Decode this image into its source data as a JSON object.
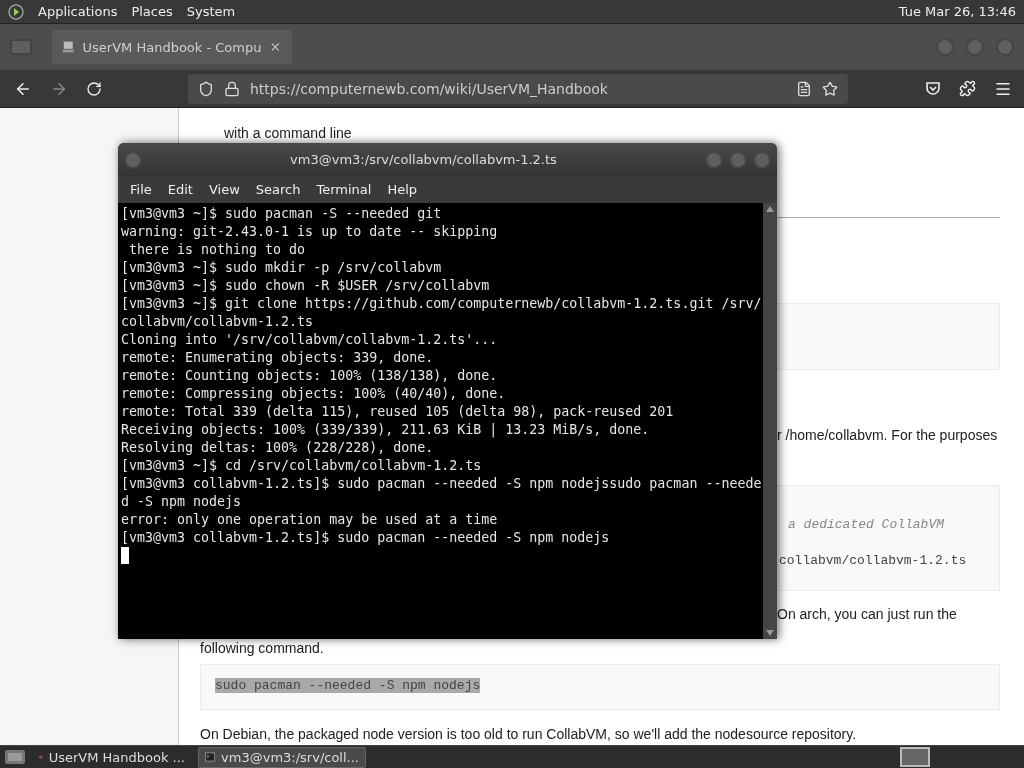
{
  "top_panel": {
    "menus": [
      "Applications",
      "Places",
      "System"
    ],
    "clock": "Tue Mar 26, 13:46"
  },
  "browser": {
    "tab": {
      "title": "UserVM Handbook - Compu",
      "selected": true
    },
    "url": "https://computernewb.com/wiki/UserVM_Handbook",
    "page": [
      {
        "kind": "list_text",
        "text": "with a command line"
      },
      {
        "kind": "rule"
      },
      {
        "kind": "code"
      },
      {
        "kind": "clipped_text",
        "text": "r /home/collabvm. For the purposes"
      },
      {
        "kind": "code",
        "lines": [
          {
            "kind": "comment",
            "text": "a dedicated CollabVM"
          },
          {
            "kind": "plain",
            "text": "collabvm/collabvm-1.2.ts"
          }
        ]
      },
      {
        "kind": "clipped_text",
        "text": "On arch, you can just run the"
      },
      {
        "kind": "text",
        "text": "following command."
      },
      {
        "kind": "code",
        "lines": [
          {
            "kind": "selected",
            "text": "sudo pacman --needed -S npm nodejs"
          }
        ]
      },
      {
        "kind": "text",
        "text": "On Debian, the packaged node version is too old to run CollabVM, so we'll add the nodesource repository."
      }
    ]
  },
  "terminal": {
    "title": "vm3@vm3:/srv/collabvm/collabvm-1.2.ts",
    "menus": [
      "File",
      "Edit",
      "View",
      "Search",
      "Terminal",
      "Help"
    ],
    "lines": [
      "[vm3@vm3 ~]$ sudo pacman -S --needed git",
      "warning: git-2.43.0-1 is up to date -- skipping",
      " there is nothing to do",
      "[vm3@vm3 ~]$ sudo mkdir -p /srv/collabvm",
      "[vm3@vm3 ~]$ sudo chown -R $USER /srv/collabvm",
      "[vm3@vm3 ~]$ git clone https://github.com/computernewb/collabvm-1.2.ts.git /srv/",
      "collabvm/collabvm-1.2.ts",
      "Cloning into '/srv/collabvm/collabvm-1.2.ts'...",
      "remote: Enumerating objects: 339, done.",
      "remote: Counting objects: 100% (138/138), done.",
      "remote: Compressing objects: 100% (40/40), done.",
      "remote: Total 339 (delta 115), reused 105 (delta 98), pack-reused 201",
      "Receiving objects: 100% (339/339), 211.63 KiB | 13.23 MiB/s, done.",
      "Resolving deltas: 100% (228/228), done.",
      "[vm3@vm3 ~]$ cd /srv/collabvm/collabvm-1.2.ts",
      "[vm3@vm3 collabvm-1.2.ts]$ sudo pacman --needed -S npm nodejssudo pacman --neede",
      "d -S npm nodejs",
      "error: only one operation may be used at a time",
      "[vm3@vm3 collabvm-1.2.ts]$ sudo pacman --needed -S npm nodejs"
    ]
  },
  "taskbar": {
    "items": [
      {
        "kind": "browser",
        "label": "UserVM Handbook ...",
        "selected": false
      },
      {
        "kind": "terminal",
        "label": "vm3@vm3:/srv/coll...",
        "selected": true
      }
    ]
  }
}
